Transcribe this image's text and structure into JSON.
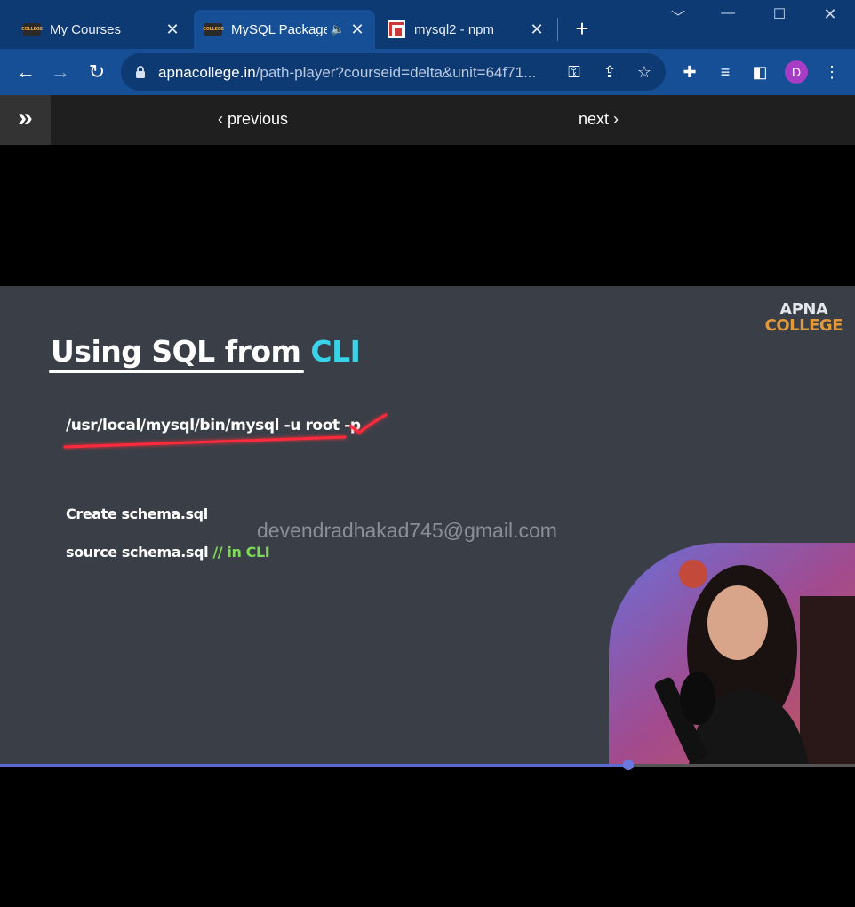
{
  "tabs": [
    {
      "title": "My Courses",
      "favicon": "apna-college-icon",
      "active": false
    },
    {
      "title": "MySQL Package",
      "favicon": "apna-college-icon",
      "active": true,
      "audio": true
    },
    {
      "title": "mysql2 - npm",
      "favicon": "npm-icon",
      "active": false
    }
  ],
  "favicon_text": "COLLEGE",
  "address": {
    "domain": "apnacollege.in",
    "path": "/path-player?courseid=delta&unit=64f71..."
  },
  "profile_initial": "D",
  "player_nav": {
    "previous": "previous",
    "next": "next"
  },
  "slide": {
    "title_main": "Using SQL from ",
    "title_accent": "CLI",
    "brand_line1": "APNA",
    "brand_line2": "COLLEGE",
    "command": "/usr/local/mysql/bin/mysql -u root -p",
    "line2": "Create schema.sql",
    "line3_main": "source schema.sql ",
    "line3_comment": "// in CLI",
    "watermark": "devendradhakad745@gmail.com"
  },
  "progress": 0.735,
  "colors": {
    "tabstrip": "#0d3a73",
    "toolbar": "#164f96",
    "slide_bg": "#3a3f47",
    "accent_cli": "#38d3e8",
    "comment": "#7ed957",
    "brand_orange": "#e09a3b",
    "progress": "#5a6ad0"
  }
}
